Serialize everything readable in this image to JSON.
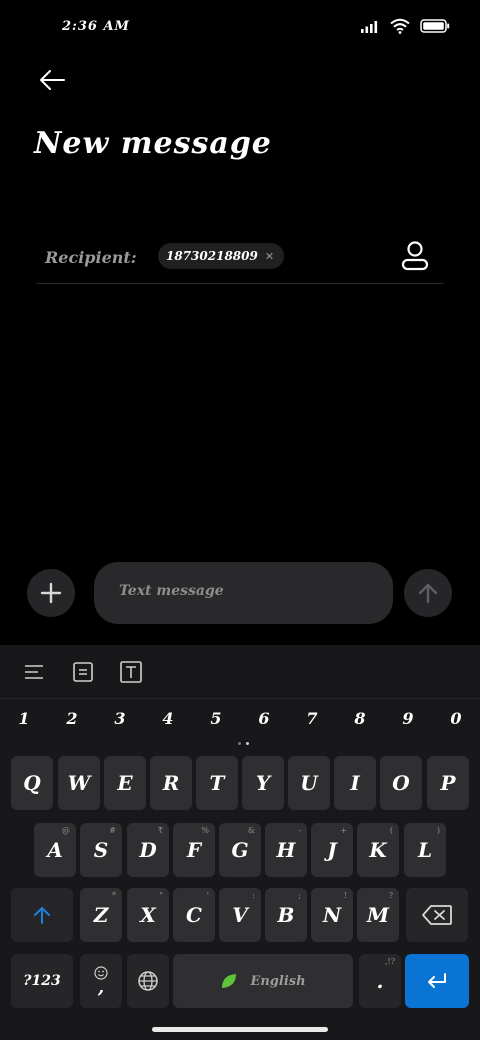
{
  "status_bar": {
    "time": "2:36 AM"
  },
  "header": {
    "title": "New message"
  },
  "recipient": {
    "label": "Recipient:",
    "chips": [
      "18730218809"
    ]
  },
  "compose": {
    "placeholder": "Text message"
  },
  "keyboard": {
    "numbers": [
      "1",
      "2",
      "3",
      "4",
      "5",
      "6",
      "7",
      "8",
      "9",
      "0"
    ],
    "row1": [
      {
        "letter": "Q",
        "hint": ""
      },
      {
        "letter": "W",
        "hint": ""
      },
      {
        "letter": "E",
        "hint": ""
      },
      {
        "letter": "R",
        "hint": ""
      },
      {
        "letter": "T",
        "hint": ""
      },
      {
        "letter": "Y",
        "hint": ""
      },
      {
        "letter": "U",
        "hint": ""
      },
      {
        "letter": "I",
        "hint": ""
      },
      {
        "letter": "O",
        "hint": ""
      },
      {
        "letter": "P",
        "hint": ""
      }
    ],
    "row2": [
      {
        "letter": "A",
        "hint": "@"
      },
      {
        "letter": "S",
        "hint": "#"
      },
      {
        "letter": "D",
        "hint": "₹"
      },
      {
        "letter": "F",
        "hint": "%"
      },
      {
        "letter": "G",
        "hint": "&"
      },
      {
        "letter": "H",
        "hint": "-"
      },
      {
        "letter": "J",
        "hint": "+"
      },
      {
        "letter": "K",
        "hint": "("
      },
      {
        "letter": "L",
        "hint": ")"
      }
    ],
    "row3": [
      {
        "letter": "Z",
        "hint": "*"
      },
      {
        "letter": "X",
        "hint": "\""
      },
      {
        "letter": "C",
        "hint": "'"
      },
      {
        "letter": "V",
        "hint": ":"
      },
      {
        "letter": "B",
        "hint": ";"
      },
      {
        "letter": "N",
        "hint": "!"
      },
      {
        "letter": "M",
        "hint": "?"
      }
    ],
    "symbols_key": "?123",
    "comma_key": ",",
    "space_label": "English",
    "period_key": ".",
    "period_hint": ",!?"
  },
  "colors": {
    "accent": "#0a74d4",
    "leaf": "#5ec23a",
    "key": "#2f2f31",
    "background": "#000000"
  }
}
